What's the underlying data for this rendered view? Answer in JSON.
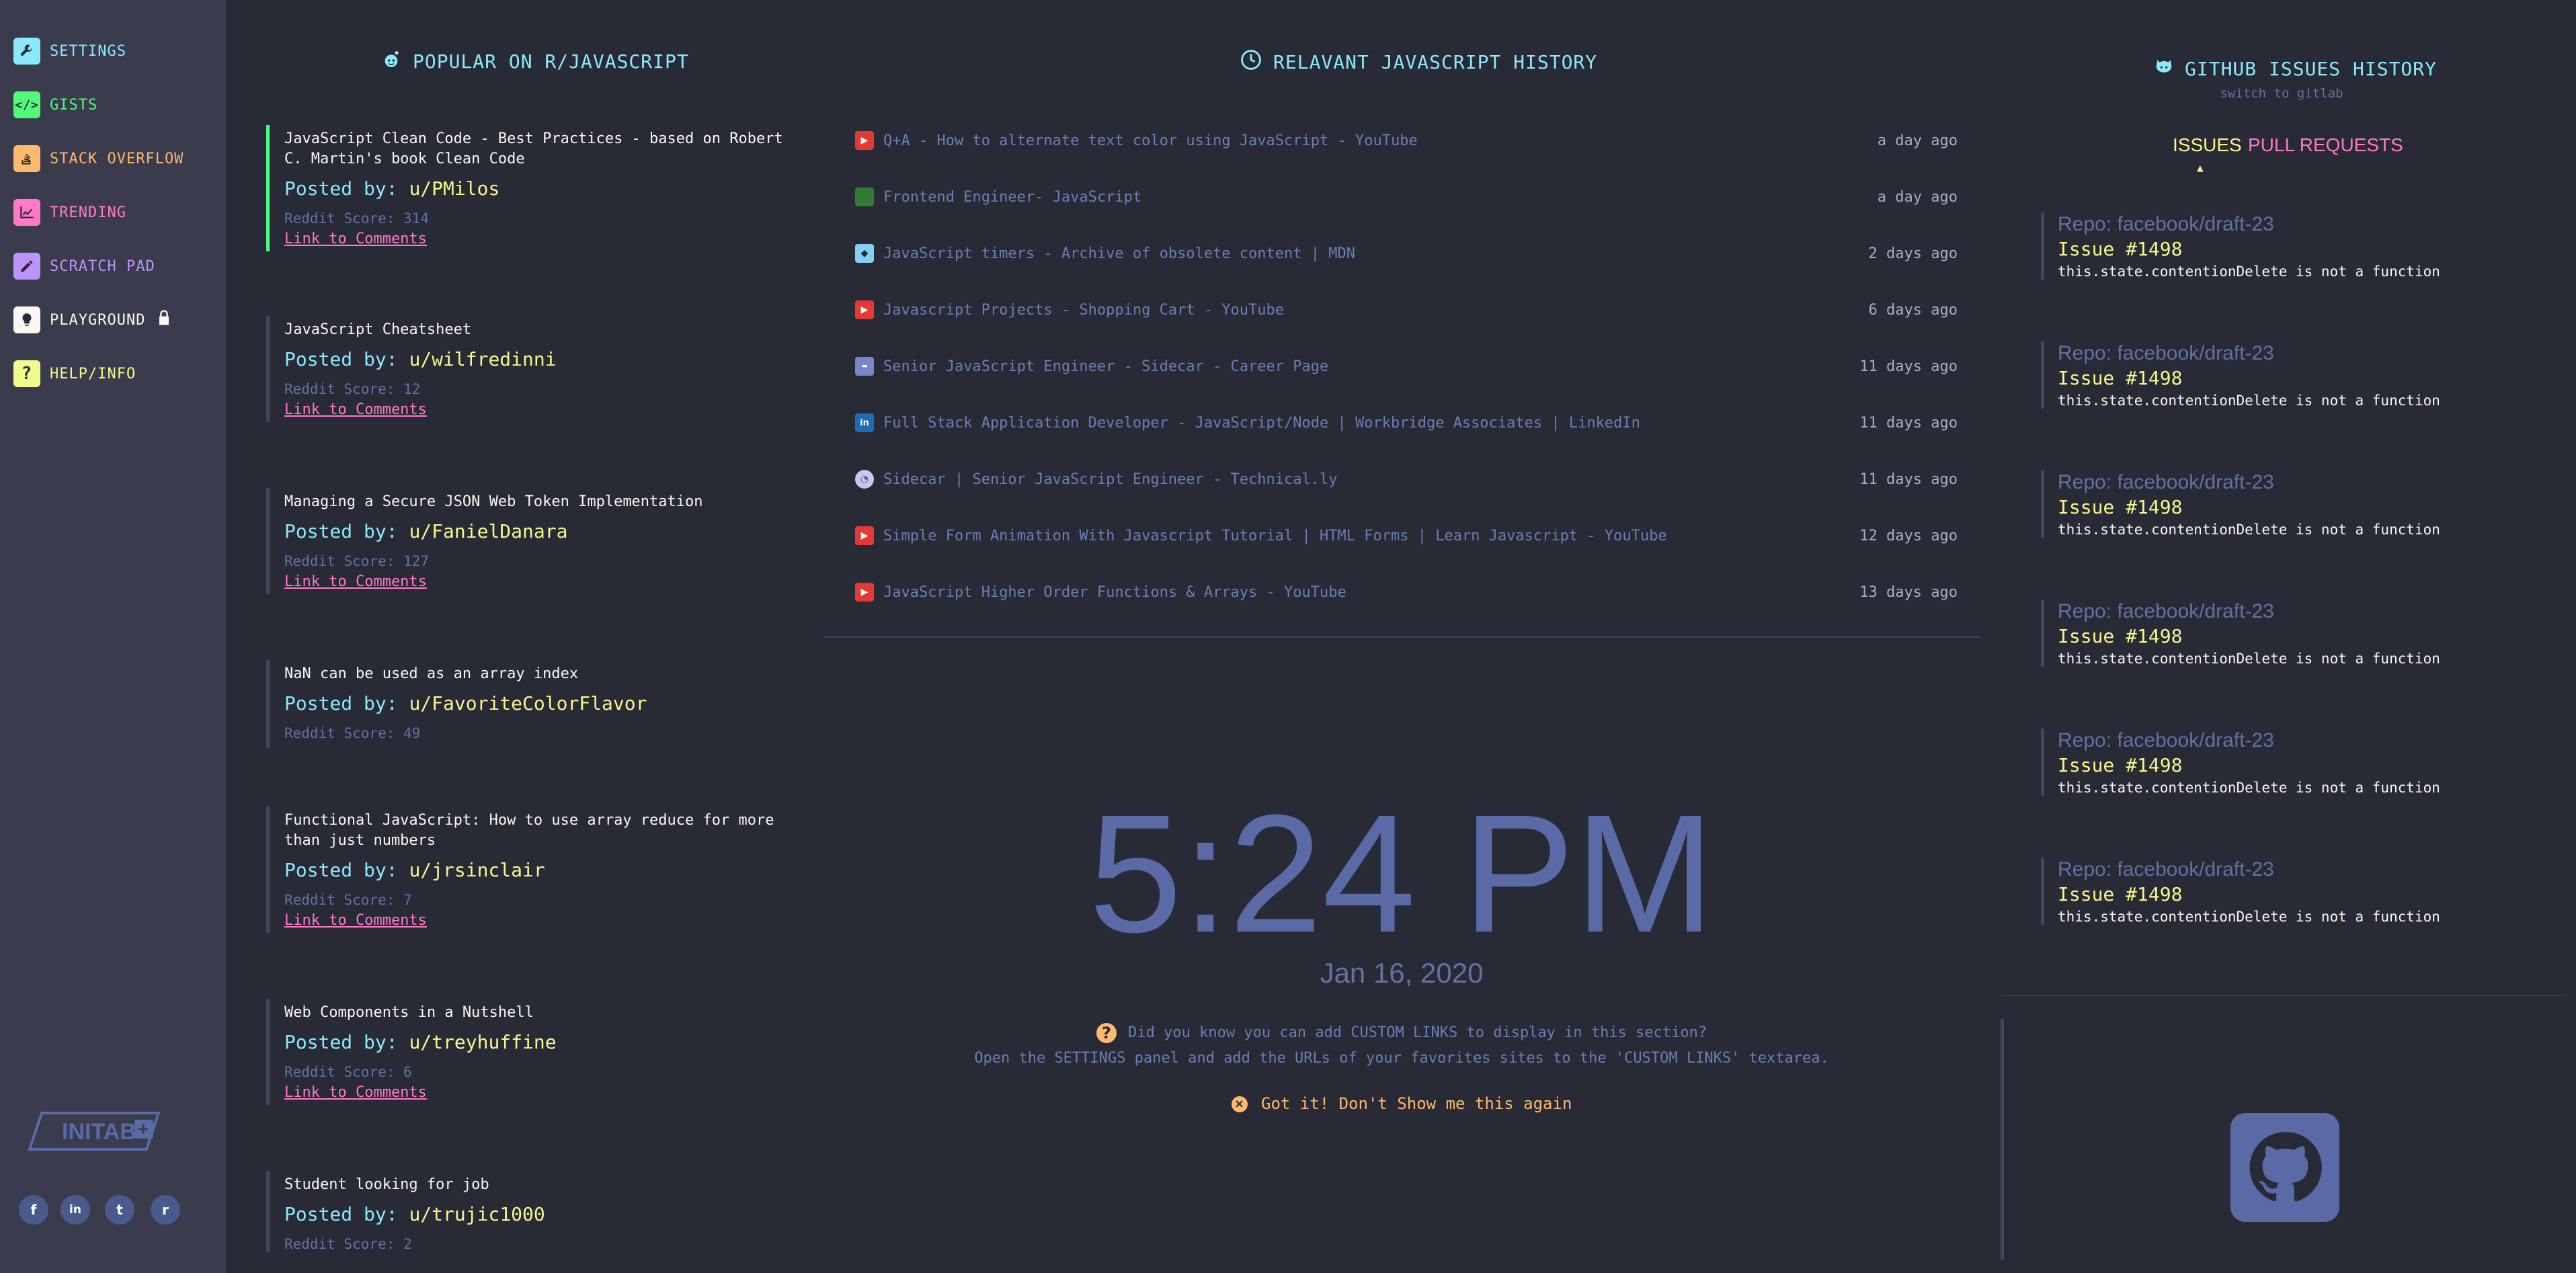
{
  "sidebar": {
    "items": [
      {
        "label": "SETTINGS",
        "icon": "wrench-icon",
        "color": "#8be9fd"
      },
      {
        "label": "GISTS",
        "icon": "code-icon",
        "color": "#50fa7b"
      },
      {
        "label": "STACK OVERFLOW",
        "icon": "stack-overflow-icon",
        "color": "#ffb86c"
      },
      {
        "label": "TRENDING",
        "icon": "chart-icon",
        "color": "#ff79c6"
      },
      {
        "label": "SCRATCH PAD",
        "icon": "pencil-icon",
        "color": "#bd93f9"
      },
      {
        "label": "PLAYGROUND",
        "icon": "bulb-icon",
        "color": "#f8f8f2"
      },
      {
        "label": "HELP/INFO",
        "icon": "question-icon",
        "color": "#f1fa8c"
      }
    ],
    "logo_text": "INITAB",
    "social": [
      "f",
      "in",
      "t",
      "r"
    ]
  },
  "reddit": {
    "title": "POPULAR ON R/JAVASCRIPT",
    "posted_prefix": "Posted by:",
    "score_prefix": "Reddit Score:",
    "link_label": "Link to Comments",
    "posts": [
      {
        "title": "JavaScript Clean Code - Best Practices - based on Robert C. Martin's book Clean Code",
        "user": "u/PMilos",
        "score": "314"
      },
      {
        "title": "JavaScript Cheatsheet",
        "user": "u/wilfredinni",
        "score": "12"
      },
      {
        "title": "Managing a Secure JSON Web Token Implementation",
        "user": "u/FanielDanara",
        "score": "127"
      },
      {
        "title": "NaN can be used as an array index",
        "user": "u/FavoriteColorFlavor",
        "score": "49"
      },
      {
        "title": "Functional JavaScript: How to use array reduce for more than just numbers",
        "user": "u/jrsinclair",
        "score": "7"
      },
      {
        "title": "Web Components in a Nutshell",
        "user": "u/treyhuffine",
        "score": "6"
      },
      {
        "title": "Student looking for job",
        "user": "u/trujic1000",
        "score": "2"
      }
    ]
  },
  "history": {
    "title": "RELAVANT JAVASCRIPT HISTORY",
    "items": [
      {
        "title": " Q+A - How to alternate text color using JavaScript - YouTube",
        "time": "a day ago",
        "favicon": "youtube"
      },
      {
        "title": "Frontend Engineer- JavaScript",
        "time": "a day ago",
        "favicon": "green"
      },
      {
        "title": "JavaScript timers - Archive of obsolete content | MDN",
        "time": "2 days ago",
        "favicon": "mdn"
      },
      {
        "title": "Javascript Projects - Shopping Cart - YouTube",
        "time": "6 days ago",
        "favicon": "youtube"
      },
      {
        "title": "Senior JavaScript Engineer - Sidecar - Career Page",
        "time": "11 days ago",
        "favicon": "career"
      },
      {
        "title": "Full Stack Application Developer - JavaScript/Node | Workbridge Associates | LinkedIn",
        "time": "11 days ago",
        "favicon": "linkedin"
      },
      {
        "title": "Sidecar | Senior JavaScript Engineer - Technical.ly",
        "time": "11 days ago",
        "favicon": "technically"
      },
      {
        "title": "Simple Form Animation With Javascript Tutorial | HTML Forms | Learn Javascript - YouTube",
        "time": "12 days ago",
        "favicon": "youtube"
      },
      {
        "title": "JavaScript Higher Order Functions & Arrays - YouTube",
        "time": "13 days ago",
        "favicon": "youtube"
      }
    ]
  },
  "clock": {
    "time": "5:24 PM",
    "date": "Jan 16, 2020"
  },
  "tip": {
    "line1": "Did you know you can add CUSTOM LINKS to display in this section?",
    "line2": "Open the SETTINGS panel and add the URLs of your favorites sites to the 'CUSTOM LINKS' textarea.",
    "dismiss": "Got it! Don't Show me this again"
  },
  "github": {
    "title": "GITHUB ISSUES HISTORY",
    "switch": "switch to gitlab",
    "tabs": [
      "ISSUES",
      "PULL REQUESTS"
    ],
    "items": [
      {
        "repo": "Repo: facebook/draft-23",
        "issue": "Issue #1498",
        "text": "this.state.contentionDelete is not a function"
      },
      {
        "repo": "Repo: facebook/draft-23",
        "issue": "Issue #1498",
        "text": "this.state.contentionDelete is not a function"
      },
      {
        "repo": "Repo: facebook/draft-23",
        "issue": "Issue #1498",
        "text": "this.state.contentionDelete is not a function"
      },
      {
        "repo": "Repo: facebook/draft-23",
        "issue": "Issue #1498",
        "text": "this.state.contentionDelete is not a function"
      },
      {
        "repo": "Repo: facebook/draft-23",
        "issue": "Issue #1498",
        "text": "this.state.contentionDelete is not a function"
      },
      {
        "repo": "Repo: facebook/draft-23",
        "issue": "Issue #1498",
        "text": "this.state.contentionDelete is not a function"
      }
    ]
  }
}
